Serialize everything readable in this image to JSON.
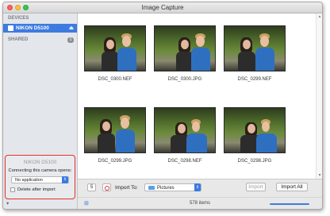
{
  "window": {
    "title": "Image Capture"
  },
  "sidebar": {
    "devices_header": "DEVICES",
    "device_name": "NIKON D5100",
    "shared_header": "SHARED",
    "shared_count": "1"
  },
  "camera_panel": {
    "camera_name": "NIKON D5100",
    "connecting_label": "Connecting this camera opens:",
    "app_selected": "No application",
    "delete_after_import_label": "Delete after import",
    "delete_after_import_checked": false
  },
  "thumbnails": [
    {
      "filename": "DSC_0300.NEF"
    },
    {
      "filename": "DSC_0300.JPG"
    },
    {
      "filename": "DSC_0299.NEF"
    },
    {
      "filename": "DSC_0299.JPG"
    },
    {
      "filename": "DSC_0298.NEF"
    },
    {
      "filename": "DSC_0298.JPG"
    }
  ],
  "toolbar": {
    "count_value": "5",
    "import_to_label": "Import To:",
    "import_destination": "Pictures",
    "import_button": "Import",
    "import_all_button": "Import All"
  },
  "status": {
    "items_label": "578 items"
  },
  "icons": {
    "eject": "eject-icon",
    "folder": "folder-icon",
    "delete": "no-entry-icon"
  },
  "colors": {
    "accent": "#3d7be0",
    "highlight_border": "#e4322b"
  }
}
